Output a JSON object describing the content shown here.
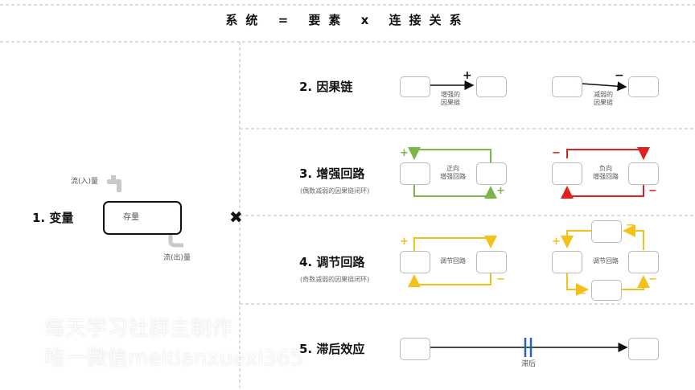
{
  "title": "系统  =  要素  x  连接关系",
  "rows": {
    "variable": {
      "label": "1. 变量",
      "stock": "存量",
      "inflow": "流(入)量",
      "outflow": "流(出)量"
    },
    "causal": {
      "label": "2. 因果链",
      "pos_sign": "+",
      "neg_sign": "−",
      "pos_caption": "增强的\n因果链",
      "neg_caption": "减弱的\n因果链"
    },
    "reinforcing": {
      "label": "3. 增强回路",
      "sub": "(偶数减弱的因果链闭环)",
      "pos_text": "正向\n增强回路",
      "neg_text": "负向\n增强回路",
      "plus": "+",
      "minus": "−"
    },
    "balancing": {
      "label": "4. 调节回路",
      "sub": "(奇数减弱的因果链闭环)",
      "text_a": "调节回路",
      "text_b": "调节回路",
      "plus": "+",
      "minus": "−"
    },
    "delay": {
      "label": "5. 滞后效应",
      "caption": "滞后"
    }
  },
  "operator": "✖",
  "watermark": [
    "每天学习社群主制作",
    "唯一微信meitianxuexi365"
  ],
  "colors": {
    "green": "#7ab648",
    "red": "#e02020",
    "yellow": "#f2c21b",
    "blue": "#2f5fb3",
    "dash": "#bbbbbb"
  }
}
